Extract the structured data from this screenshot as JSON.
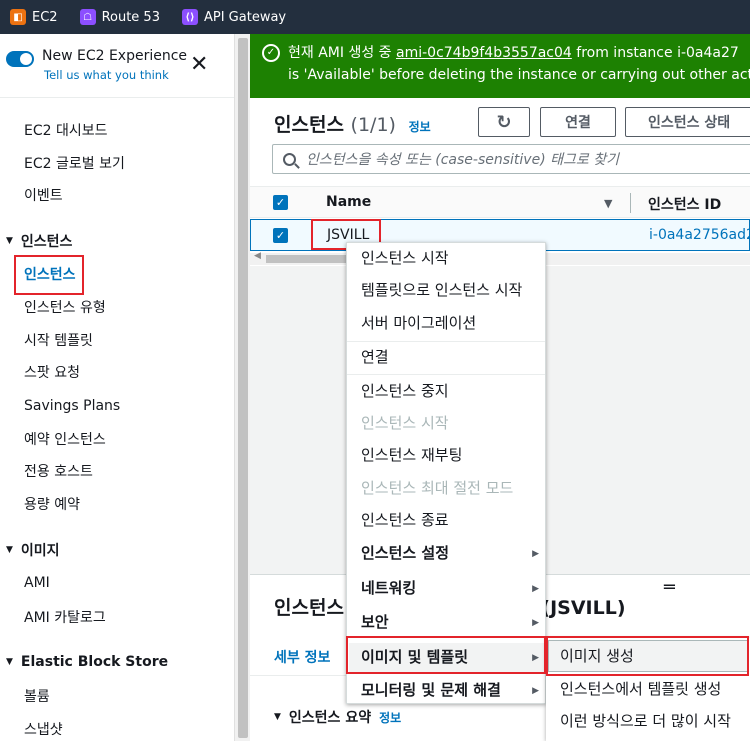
{
  "topbar": {
    "services": [
      {
        "label": "EC2",
        "icon": "ec2-icon",
        "color": "#ec7211"
      },
      {
        "label": "Route 53",
        "icon": "route53-icon",
        "color": "#8c4fff"
      },
      {
        "label": "API Gateway",
        "icon": "api-gateway-icon",
        "color": "#8c4fff"
      }
    ]
  },
  "sidebar": {
    "experience_title": "New EC2 Experience",
    "experience_sub": "Tell us what you think",
    "items": {
      "dashboard": "EC2 대시보드",
      "global_view": "EC2 글로벌 보기",
      "events": "이벤트",
      "instances_group": "인스턴스",
      "instances": "인스턴스",
      "instance_types": "인스턴스 유형",
      "launch_templates": "시작 템플릿",
      "spot_requests": "스팟 요청",
      "savings_plans": "Savings Plans",
      "reserved": "예약 인스턴스",
      "dedicated_hosts": "전용 호스트",
      "capacity": "용량 예약",
      "images_group": "이미지",
      "ami": "AMI",
      "ami_catalog": "AMI 카탈로그",
      "ebs_group": "Elastic Block Store",
      "volumes": "볼륨",
      "snapshots": "스냅샷"
    }
  },
  "flash": {
    "prefix": "현재 AMI 생성 중 ",
    "ami_id": "ami-0c74b9f4b3557ac04",
    "suffix": " from instance i-0a4a27",
    "line2": "is 'Available' before deleting the instance or carrying out other acti"
  },
  "instances_panel": {
    "title": "인스턴스",
    "count": "(1/1)",
    "info": "정보",
    "connect_button": "연결",
    "state_button": "인스턴스 상태",
    "search_placeholder": "인스턴스을 속성 또는 (case-sensitive) 태그로 찾기",
    "columns": {
      "name": "Name",
      "id": "인스턴스 ID"
    },
    "row": {
      "name": "JSVILL",
      "id": "i-0a4a2756ad2"
    }
  },
  "details_panel": {
    "title": "인스턴스 i-0a4a2756ad2f0(JSVILL)",
    "title_visible_prefix": "인스턴스",
    "title_visible_suffix": "f0(JSVILL)",
    "tab_details": "세부 정보",
    "summary": "인스턴스 요약",
    "summary_info": "정보"
  },
  "context_menu": {
    "launch_instance": "인스턴스 시작",
    "launch_from_template": "템플릿으로 인스턴스 시작",
    "server_migration": "서버 마이그레이션",
    "connect": "연결",
    "stop": "인스턴스 중지",
    "start": "인스턴스 시작",
    "reboot": "인스턴스 재부팅",
    "hibernate": "인스턴스 최대 절전 모드",
    "terminate": "인스턴스 종료",
    "settings": "인스턴스 설정",
    "networking": "네트워킹",
    "security": "보안",
    "image_templates": "이미지 및 템플릿",
    "monitoring": "모니터링 및 문제 해결"
  },
  "submenu": {
    "create_image": "이미지 생성",
    "create_template": "인스턴스에서 템플릿 생성",
    "launch_more": "이런 방식으로 더 많이 시작"
  }
}
